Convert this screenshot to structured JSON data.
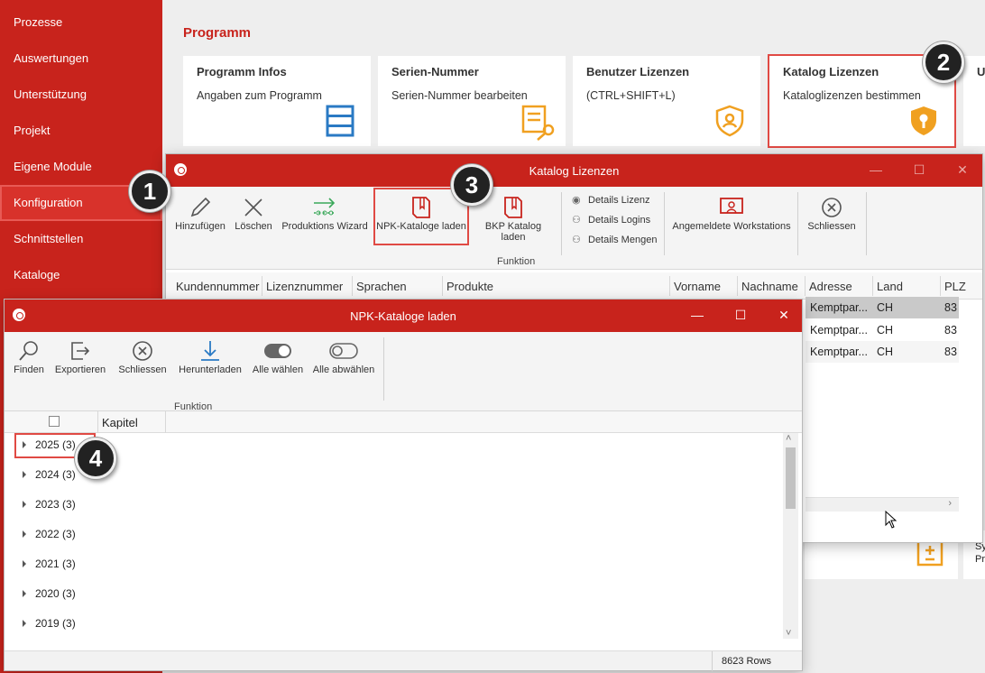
{
  "sidebar": {
    "items": [
      {
        "label": "Prozesse"
      },
      {
        "label": "Auswertungen"
      },
      {
        "label": "Unterstützung"
      },
      {
        "label": "Projekt"
      },
      {
        "label": "Eigene Module"
      },
      {
        "label": "Konfiguration"
      },
      {
        "label": "Schnittstellen"
      },
      {
        "label": "Kataloge"
      }
    ]
  },
  "main": {
    "section_title": "Programm",
    "tiles": [
      {
        "title": "Programm Infos",
        "subtitle": "Angaben zum Programm",
        "icon": "list-icon"
      },
      {
        "title": "Serien-Nummer",
        "subtitle": "Serien-Nummer bearbeiten",
        "icon": "key-document-icon"
      },
      {
        "title": "Benutzer Lizenzen",
        "subtitle": "(CTRL+SHIFT+L)",
        "icon": "shield-user-icon"
      },
      {
        "title": "Katalog Lizenzen",
        "subtitle": "Kataloglizenzen bestimmen",
        "icon": "shield-key-icon"
      },
      {
        "title": "U",
        "subtitle": "",
        "icon": ""
      }
    ],
    "partial_tile_text": [
      "Sy",
      "Pr"
    ]
  },
  "badges": [
    "1",
    "2",
    "3",
    "4"
  ],
  "katalog_window": {
    "title": "Katalog Lizenzen",
    "controls": {
      "minimize": "—",
      "maximize": "☐",
      "close": "✕"
    },
    "ribbon": {
      "buttons": [
        {
          "label": "Hinzufügen",
          "icon": "pencil-icon"
        },
        {
          "label": "Löschen",
          "icon": "x-icon"
        },
        {
          "label": "Produktions Wizard",
          "icon": "wizard-arrow-icon"
        },
        {
          "label": "NPK-Kataloge laden",
          "icon": "book-icon"
        },
        {
          "label": "BKP Katalog laden",
          "icon": "book-icon"
        }
      ],
      "small_buttons": [
        {
          "label": "Details Lizenz",
          "icon": "eye-icon"
        },
        {
          "label": "Details Logins",
          "icon": "users-icon"
        },
        {
          "label": "Details Mengen",
          "icon": "users-icon"
        }
      ],
      "workstations_label": "Angemeldete Workstations",
      "close_label": "Schliessen",
      "group_label": "Funktion"
    },
    "columns": [
      "Kundennummer",
      "Lizenznummer",
      "Sprachen",
      "Produkte",
      "Vorname",
      "Nachname",
      "Adresse",
      "Land",
      "PLZ"
    ],
    "rows": [
      {
        "adresse": "Kemptpar...",
        "land": "CH",
        "plz": "83"
      },
      {
        "adresse": "Kemptpar...",
        "land": "CH",
        "plz": "83"
      },
      {
        "adresse": "Kemptpar...",
        "land": "CH",
        "plz": "83"
      }
    ]
  },
  "npk_window": {
    "title": "NPK-Kataloge laden",
    "controls": {
      "minimize": "—",
      "maximize": "☐",
      "close": "✕"
    },
    "ribbon": {
      "buttons": [
        {
          "label": "Finden",
          "icon": "search-icon"
        },
        {
          "label": "Exportieren",
          "icon": "export-icon"
        },
        {
          "label": "Schliessen",
          "icon": "close-circle-icon"
        },
        {
          "label": "Herunterladen",
          "icon": "download-icon"
        },
        {
          "label": "Alle wählen",
          "icon": "toggle-on-icon"
        },
        {
          "label": "Alle abwählen",
          "icon": "toggle-off-icon"
        }
      ],
      "group_label": "Funktion"
    },
    "column_header": "Kapitel",
    "tree": [
      {
        "label": "2025 (3)"
      },
      {
        "label": "2024 (3)"
      },
      {
        "label": "2023 (3)"
      },
      {
        "label": "2022 (3)"
      },
      {
        "label": "2021 (3)"
      },
      {
        "label": "2020 (3)"
      },
      {
        "label": "2019 (3)"
      }
    ],
    "status": "8623 Rows"
  },
  "colors": {
    "brand_red": "#c8231c",
    "icon_blue": "#2a7ac4",
    "icon_orange": "#f0a020",
    "icon_green": "#3aa85a"
  }
}
